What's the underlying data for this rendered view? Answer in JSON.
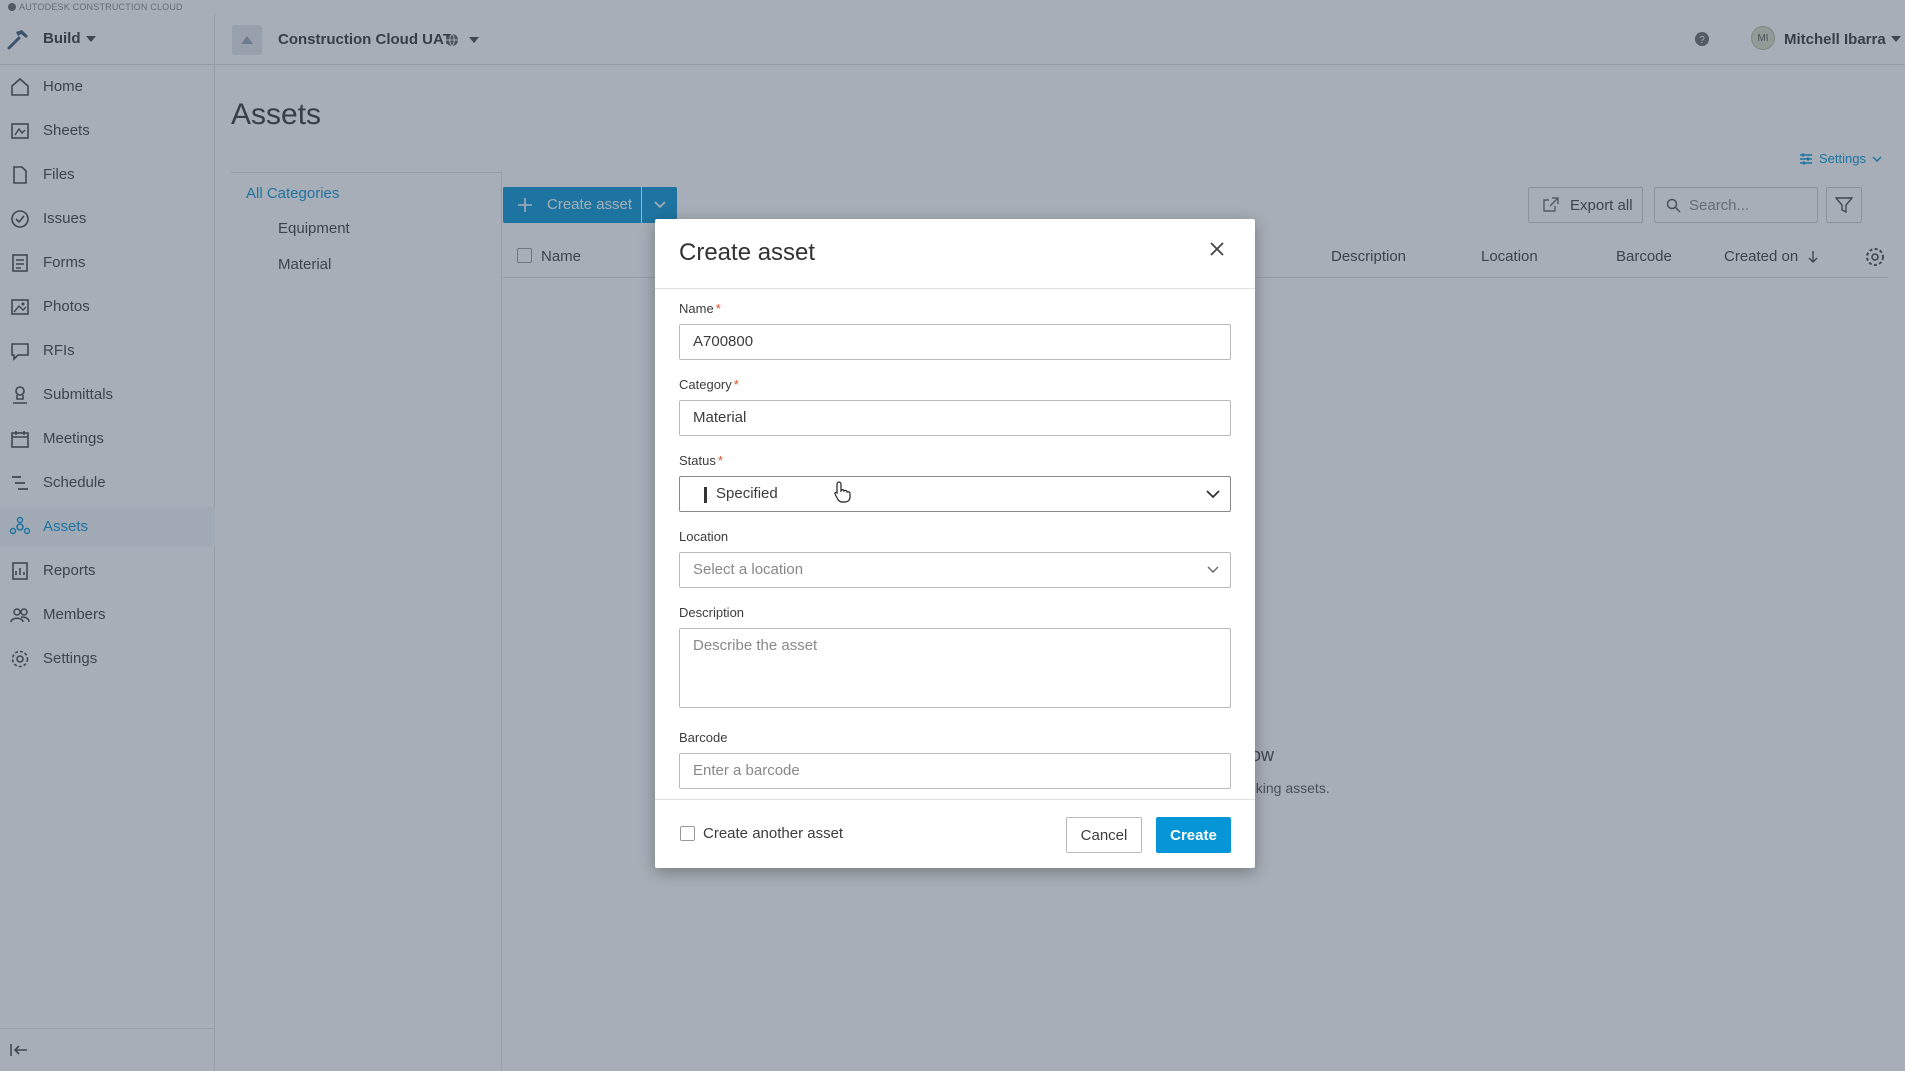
{
  "topbar": {
    "brand_text": "AUTODESK CONSTRUCTION CLOUD"
  },
  "header": {
    "product": "Build",
    "project": "Construction Cloud UAT",
    "user_initials": "MI",
    "user_name": "Mitchell Ibarra"
  },
  "sidebar": {
    "active": "Assets",
    "items": [
      {
        "label": "Home",
        "icon": "home-icon"
      },
      {
        "label": "Sheets",
        "icon": "sheets-icon"
      },
      {
        "label": "Files",
        "icon": "files-icon"
      },
      {
        "label": "Issues",
        "icon": "issues-icon"
      },
      {
        "label": "Forms",
        "icon": "forms-icon"
      },
      {
        "label": "Photos",
        "icon": "photos-icon"
      },
      {
        "label": "RFIs",
        "icon": "rfis-icon"
      },
      {
        "label": "Submittals",
        "icon": "submittals-icon"
      },
      {
        "label": "Meetings",
        "icon": "meetings-icon"
      },
      {
        "label": "Schedule",
        "icon": "schedule-icon"
      },
      {
        "label": "Assets",
        "icon": "assets-icon"
      },
      {
        "label": "Reports",
        "icon": "reports-icon"
      },
      {
        "label": "Members",
        "icon": "members-icon"
      },
      {
        "label": "Settings",
        "icon": "settings-icon"
      }
    ]
  },
  "page": {
    "title": "Assets",
    "settings_label": "Settings",
    "categories": {
      "all": "All Categories",
      "items": [
        "Equipment",
        "Material"
      ]
    },
    "toolbar": {
      "create_label": "Create asset",
      "export_label": "Export all",
      "search_placeholder": "Search..."
    },
    "table": {
      "columns": [
        "Name",
        "Description",
        "Location",
        "Barcode",
        "Created on"
      ],
      "sort_column": "Created on",
      "sort_direction": "descending"
    },
    "empty_state": {
      "title_fragment": "now",
      "subtitle_fragment": "acking assets."
    }
  },
  "modal": {
    "title": "Create asset",
    "fields": {
      "name": {
        "label": "Name",
        "required": true,
        "value": "A700800"
      },
      "category": {
        "label": "Category",
        "required": true,
        "value": "Material"
      },
      "status": {
        "label": "Status",
        "required": true,
        "value": "Specified"
      },
      "location": {
        "label": "Location",
        "required": false,
        "placeholder": "Select a location"
      },
      "description": {
        "label": "Description",
        "required": false,
        "placeholder": "Describe the asset"
      },
      "barcode": {
        "label": "Barcode",
        "required": false,
        "placeholder": "Enter a barcode"
      }
    },
    "footer": {
      "checkbox_label": "Create another asset",
      "checkbox_checked": false,
      "cancel_label": "Cancel",
      "create_label": "Create"
    }
  },
  "colors": {
    "accent": "#0696d7",
    "required": "#d74e26",
    "overlay": "#3c4c60"
  }
}
